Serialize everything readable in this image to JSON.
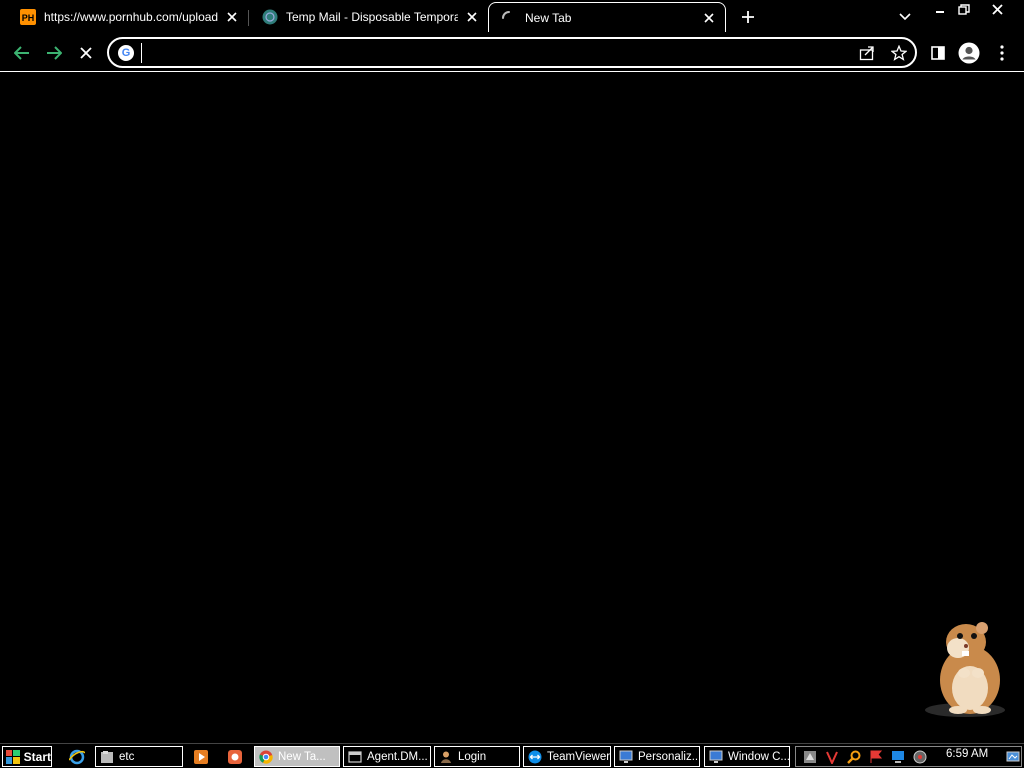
{
  "tabs": [
    {
      "title": "https://www.pornhub.com/upload/vi",
      "favicon": "ph-favicon",
      "favicon_text": "PH",
      "active": false
    },
    {
      "title": "Temp Mail - Disposable Temporary",
      "favicon": "tempmail-favicon",
      "active": false
    },
    {
      "title": "New Tab",
      "favicon": "loading-spinner-icon",
      "active": true
    }
  ],
  "omnibox": {
    "value": "",
    "placeholder": ""
  },
  "taskbar": {
    "start_label": "Start",
    "tasks": [
      {
        "label": "etc",
        "icon": "folder-icon"
      },
      {
        "label": "New Ta...",
        "icon": "chrome-icon",
        "active": true
      },
      {
        "label": "Agent.DM...",
        "icon": "window-icon"
      },
      {
        "label": "Login",
        "icon": "user-icon"
      },
      {
        "label": "TeamViewer",
        "icon": "teamviewer-icon"
      },
      {
        "label": "Personaliz...",
        "icon": "display-icon"
      },
      {
        "label": "Window C...",
        "icon": "display-icon"
      }
    ],
    "clock": "6:59 AM"
  },
  "colors": {
    "background": "#000000",
    "nav_green": "#3cb371",
    "ph_orange": "#ff9000",
    "teamviewer_blue": "#0e8ee9"
  }
}
